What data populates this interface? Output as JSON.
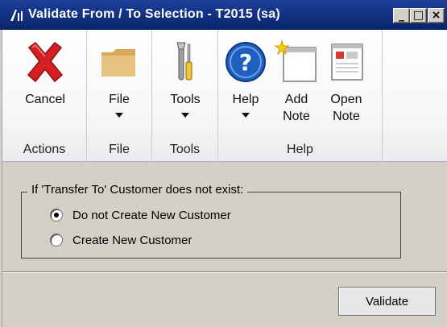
{
  "window": {
    "title": "Validate From / To Selection  -  T2015 (sa)",
    "controls": {
      "minimize": "_",
      "maximize": "□",
      "close": "×"
    }
  },
  "ribbon": {
    "groups": [
      {
        "label": "Actions",
        "buttons": [
          {
            "label": "Cancel",
            "icon": "cancel-x-icon"
          }
        ]
      },
      {
        "label": "File",
        "buttons": [
          {
            "label": "File",
            "icon": "folder-icon",
            "dropdown": true
          }
        ]
      },
      {
        "label": "Tools",
        "buttons": [
          {
            "label": "Tools",
            "icon": "tools-icon",
            "dropdown": true
          }
        ]
      },
      {
        "label": "Help",
        "buttons": [
          {
            "label": "Help",
            "icon": "help-question-icon",
            "dropdown": true
          },
          {
            "label_line1": "Add",
            "label_line2": "Note",
            "icon": "add-note-icon"
          },
          {
            "label_line1": "Open",
            "label_line2": "Note",
            "icon": "open-note-icon"
          }
        ]
      }
    ]
  },
  "options": {
    "legend": "If 'Transfer To' Customer does not exist:",
    "radios": [
      {
        "label": "Do not Create New Customer",
        "checked": true
      },
      {
        "label": "Create New Customer",
        "checked": false
      }
    ]
  },
  "actions": {
    "validate_label": "Validate"
  },
  "colors": {
    "titlebar": "#0a246a",
    "window_bg": "#d4d0c8",
    "cancel_red": "#d42020",
    "help_blue": "#1f5fbf"
  }
}
